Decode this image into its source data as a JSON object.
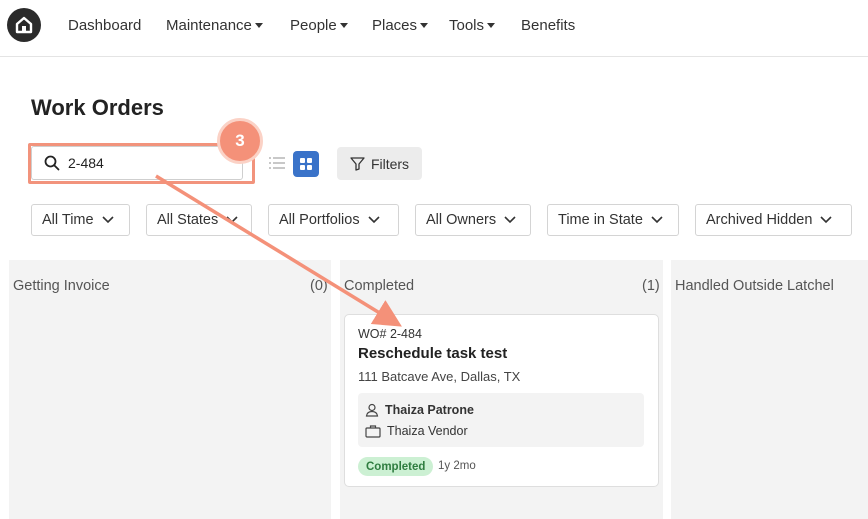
{
  "nav": {
    "items": [
      {
        "label": "Dashboard",
        "caret": false
      },
      {
        "label": "Maintenance",
        "caret": true
      },
      {
        "label": "People",
        "caret": true
      },
      {
        "label": "Places",
        "caret": true
      },
      {
        "label": "Tools",
        "caret": true
      },
      {
        "label": "Benefits",
        "caret": false
      }
    ]
  },
  "page": {
    "title": "Work Orders"
  },
  "search": {
    "value": "2-484",
    "step": "3"
  },
  "toolbar": {
    "filters_label": "Filters"
  },
  "filters": [
    "All Time",
    "All States",
    "All Portfolios",
    "All Owners",
    "Time in State",
    "Archived Hidden"
  ],
  "columns": [
    {
      "title": "Getting Invoice",
      "count": "(0)"
    },
    {
      "title": "Completed",
      "count": "(1)"
    },
    {
      "title": "Handled Outside Latchel",
      "count": ""
    }
  ],
  "card": {
    "wo_number": "WO# 2-484",
    "title": "Reschedule task test",
    "address": "111 Batcave Ave, Dallas, TX",
    "tenant": "Thaiza Patrone",
    "vendor": "Thaiza Vendor",
    "status": "Completed",
    "age": "1y 2mo"
  },
  "colors": {
    "accent": "#3a73c9",
    "annotation": "#f49179",
    "status_green_bg": "#ccf0d3",
    "status_green_text": "#2f7d40"
  },
  "icons": [
    "home-logo-icon",
    "search-icon",
    "list-view-icon",
    "grid-view-icon",
    "filter-icon",
    "chevron-down-icon",
    "person-icon",
    "briefcase-icon"
  ]
}
